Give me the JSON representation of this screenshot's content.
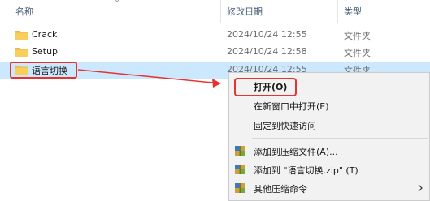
{
  "columns": {
    "name": "名称",
    "date": "修改日期",
    "type": "类型"
  },
  "files": [
    {
      "name": "Crack",
      "date": "2024/10/24 12:55",
      "type": "文件夹"
    },
    {
      "name": "Setup",
      "date": "2024/10/24 12:58",
      "type": "文件夹"
    },
    {
      "name": "语言切换",
      "date": "2024/10/24 12:55",
      "type": "文件夹"
    }
  ],
  "context_menu": {
    "items": [
      {
        "label": "打开(O)"
      },
      {
        "label": "在新窗口中打开(E)"
      },
      {
        "label": "固定到快速访问"
      },
      {
        "label": "添加到压缩文件(A)..."
      },
      {
        "label": "添加到 \"语言切换.zip\" (T)"
      },
      {
        "label": "其他压缩命令"
      }
    ]
  },
  "colors": {
    "annotation": "#e5342f",
    "selection": "#cce8ff",
    "folder": "#f7cf5a"
  }
}
